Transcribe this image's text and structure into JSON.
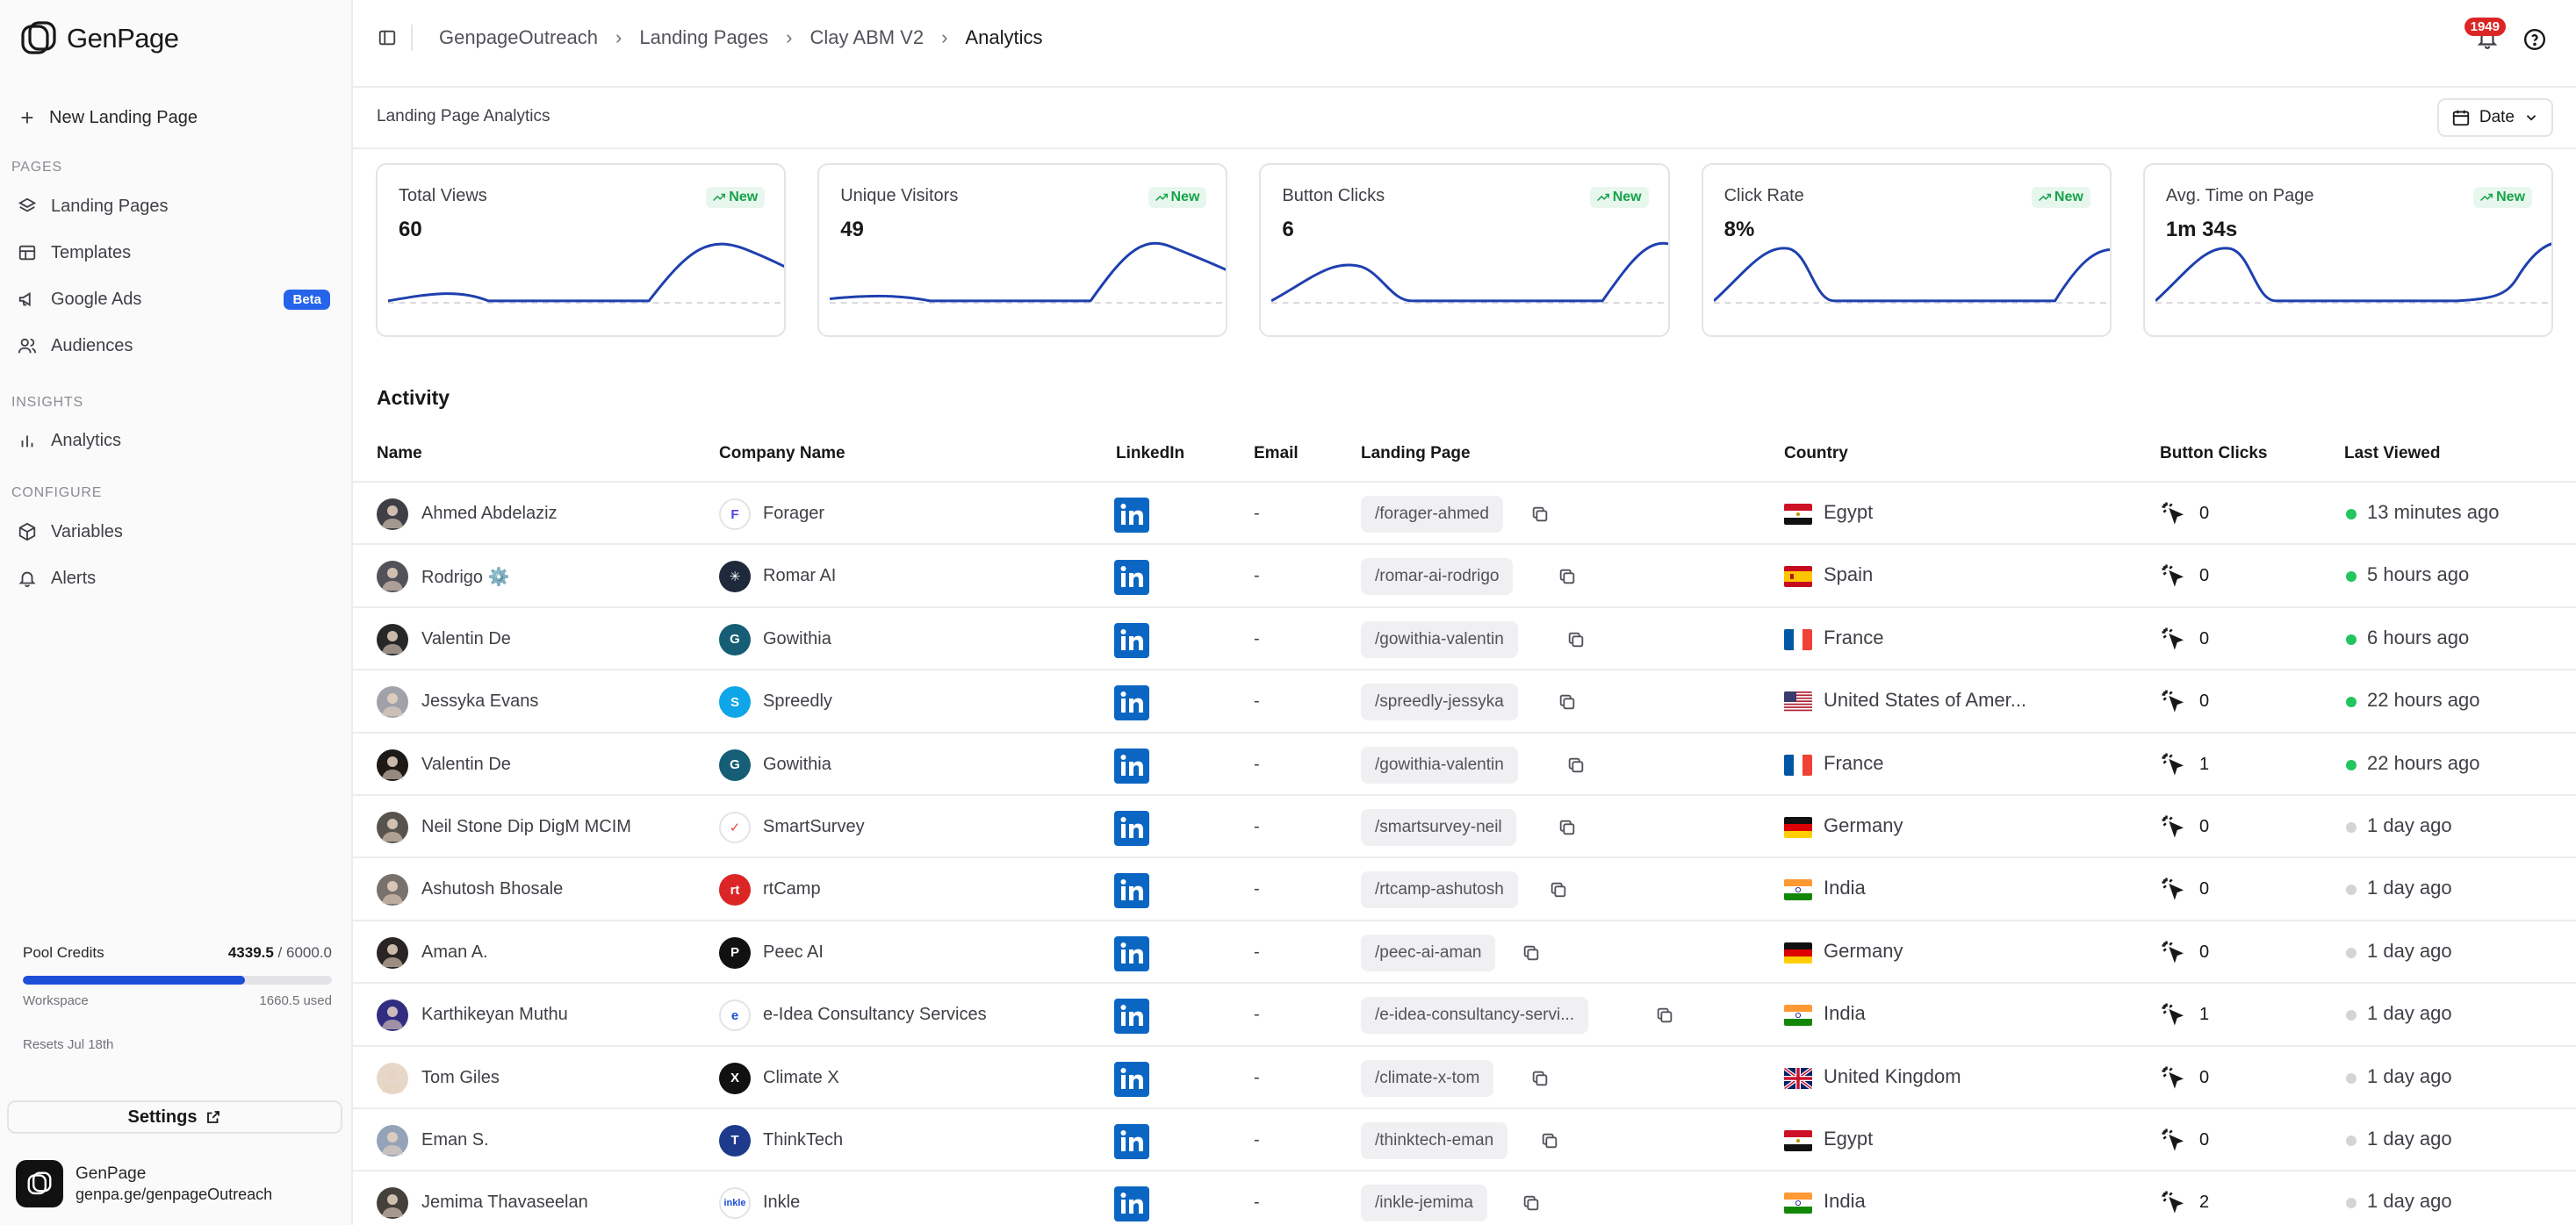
{
  "app": {
    "name": "GenPage"
  },
  "sidebar": {
    "new_button": "New Landing Page",
    "sections": {
      "pages": "PAGES",
      "insights": "INSIGHTS",
      "configure": "CONFIGURE"
    },
    "items": {
      "landing_pages": "Landing Pages",
      "templates": "Templates",
      "google_ads": "Google Ads",
      "google_ads_badge": "Beta",
      "audiences": "Audiences",
      "analytics": "Analytics",
      "variables": "Variables",
      "alerts": "Alerts"
    },
    "credits": {
      "label": "Pool Credits",
      "used_value": "4339.5",
      "total": " / 6000.0",
      "progress": 0.72,
      "workspace_label": "Workspace",
      "workspace_used": "1660.5 used",
      "resets": "Resets Jul 18th"
    },
    "settings": "Settings",
    "workspace": {
      "name": "GenPage",
      "url": "genpa.ge/genpageOutreach"
    }
  },
  "header": {
    "breadcrumbs": [
      "GenpageOutreach",
      "Landing Pages",
      "Clay ABM V2",
      "Analytics"
    ],
    "notifications": "1949"
  },
  "subheader": {
    "title": "Landing Page Analytics",
    "date_button": "Date"
  },
  "stats": [
    {
      "title": "Total Views",
      "value": "60",
      "badge": "New"
    },
    {
      "title": "Unique Visitors",
      "value": "49",
      "badge": "New"
    },
    {
      "title": "Button Clicks",
      "value": "6",
      "badge": "New"
    },
    {
      "title": "Click Rate",
      "value": "8%",
      "badge": "New"
    },
    {
      "title": "Avg. Time on Page",
      "value": "1m 34s",
      "badge": "New"
    }
  ],
  "activity": {
    "title": "Activity",
    "columns": [
      "Name",
      "Company Name",
      "LinkedIn",
      "Email",
      "Landing Page",
      "Country",
      "Button Clicks",
      "Last Viewed"
    ],
    "rows": [
      {
        "name": "Ahmed Abdelaziz",
        "company": "Forager",
        "email": "-",
        "page": "/forager-ahmed",
        "country": "Egypt",
        "clicks": "0",
        "last": "13 minutes ago",
        "recent": true
      },
      {
        "name": "Rodrigo ⚙️",
        "company": "Romar AI",
        "email": "-",
        "page": "/romar-ai-rodrigo",
        "country": "Spain",
        "clicks": "0",
        "last": "5 hours ago",
        "recent": true
      },
      {
        "name": "Valentin De",
        "company": "Gowithia",
        "email": "-",
        "page": "/gowithia-valentin",
        "country": "France",
        "clicks": "0",
        "last": "6 hours ago",
        "recent": true
      },
      {
        "name": "Jessyka Evans",
        "company": "Spreedly",
        "email": "-",
        "page": "/spreedly-jessyka",
        "country": "United States of Amer...",
        "clicks": "0",
        "last": "22 hours ago",
        "recent": true
      },
      {
        "name": "Valentin De",
        "company": "Gowithia",
        "email": "-",
        "page": "/gowithia-valentin",
        "country": "France",
        "clicks": "1",
        "last": "22 hours ago",
        "recent": true
      },
      {
        "name": "Neil Stone Dip DigM MCIM",
        "company": "SmartSurvey",
        "email": "-",
        "page": "/smartsurvey-neil",
        "country": "Germany",
        "clicks": "0",
        "last": "1 day ago",
        "recent": false
      },
      {
        "name": "Ashutosh Bhosale",
        "company": "rtCamp",
        "email": "-",
        "page": "/rtcamp-ashutosh",
        "country": "India",
        "clicks": "0",
        "last": "1 day ago",
        "recent": false
      },
      {
        "name": "Aman A.",
        "company": "Peec AI",
        "email": "-",
        "page": "/peec-ai-aman",
        "country": "Germany",
        "clicks": "0",
        "last": "1 day ago",
        "recent": false
      },
      {
        "name": "Karthikeyan Muthu",
        "company": "e-Idea Consultancy Services",
        "email": "-",
        "page": "/e-idea-consultancy-servi...",
        "country": "India",
        "clicks": "1",
        "last": "1 day ago",
        "recent": false
      },
      {
        "name": "Tom Giles",
        "company": "Climate X",
        "email": "-",
        "page": "/climate-x-tom",
        "country": "United Kingdom",
        "clicks": "0",
        "last": "1 day ago",
        "recent": false
      },
      {
        "name": "Eman S.",
        "company": "ThinkTech",
        "email": "-",
        "page": "/thinktech-eman",
        "country": "Egypt",
        "clicks": "0",
        "last": "1 day ago",
        "recent": false
      },
      {
        "name": "Jemima Thavaseelan",
        "company": "Inkle",
        "email": "-",
        "page": "/inkle-jemima",
        "country": "India",
        "clicks": "2",
        "last": "1 day ago",
        "recent": false
      }
    ]
  },
  "colors": {
    "accent": "#1d4ed8",
    "recent_dot": "#22c55e",
    "old_dot": "#d4d4d8",
    "linkedin": "#0a66c2"
  }
}
